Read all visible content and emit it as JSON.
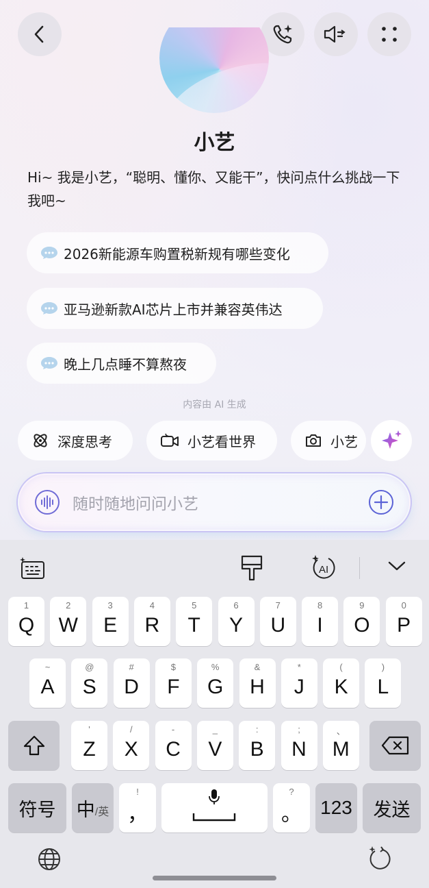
{
  "assistant": {
    "name": "小艺",
    "greeting": "Hi~ 我是小艺，“聪明、懂你、又能干”，快问点什么挑战一下我吧~"
  },
  "suggestions": [
    {
      "text": "2026新能源车购置税新规有哪些变化"
    },
    {
      "text": "亚马逊新款AI芯片上市并兼容英伟达"
    },
    {
      "text": "晚上几点睡不算熬夜"
    }
  ],
  "ai_note": "内容由 AI 生成",
  "tools": [
    {
      "label": "深度思考",
      "icon": "deep-think-icon"
    },
    {
      "label": "小艺看世界",
      "icon": "camera-video-icon"
    },
    {
      "label": "小艺",
      "icon": "camera-icon"
    }
  ],
  "input": {
    "placeholder": "随时随地问问小艺"
  },
  "keyboard": {
    "row1": [
      {
        "key": "Q",
        "hint": "1"
      },
      {
        "key": "W",
        "hint": "2"
      },
      {
        "key": "E",
        "hint": "3"
      },
      {
        "key": "R",
        "hint": "4"
      },
      {
        "key": "T",
        "hint": "5"
      },
      {
        "key": "Y",
        "hint": "6"
      },
      {
        "key": "U",
        "hint": "7"
      },
      {
        "key": "I",
        "hint": "8"
      },
      {
        "key": "O",
        "hint": "9"
      },
      {
        "key": "P",
        "hint": "0"
      }
    ],
    "row2": [
      {
        "key": "A",
        "hint": "~"
      },
      {
        "key": "S",
        "hint": "@"
      },
      {
        "key": "D",
        "hint": "#"
      },
      {
        "key": "F",
        "hint": "$"
      },
      {
        "key": "G",
        "hint": "%"
      },
      {
        "key": "H",
        "hint": "&"
      },
      {
        "key": "J",
        "hint": "*"
      },
      {
        "key": "K",
        "hint": "("
      },
      {
        "key": "L",
        "hint": ")"
      }
    ],
    "row3": [
      {
        "key": "Z",
        "hint": "'"
      },
      {
        "key": "X",
        "hint": "/"
      },
      {
        "key": "C",
        "hint": "-"
      },
      {
        "key": "V",
        "hint": "_"
      },
      {
        "key": "B",
        "hint": ":"
      },
      {
        "key": "N",
        "hint": ";"
      },
      {
        "key": "M",
        "hint": "、"
      }
    ],
    "symbols": "符号",
    "lang_main": "中",
    "lang_sub": "/英",
    "comma": "，",
    "comma_hint": "!",
    "period": "。",
    "period_hint": "?",
    "numbers": "123",
    "send": "发送"
  }
}
